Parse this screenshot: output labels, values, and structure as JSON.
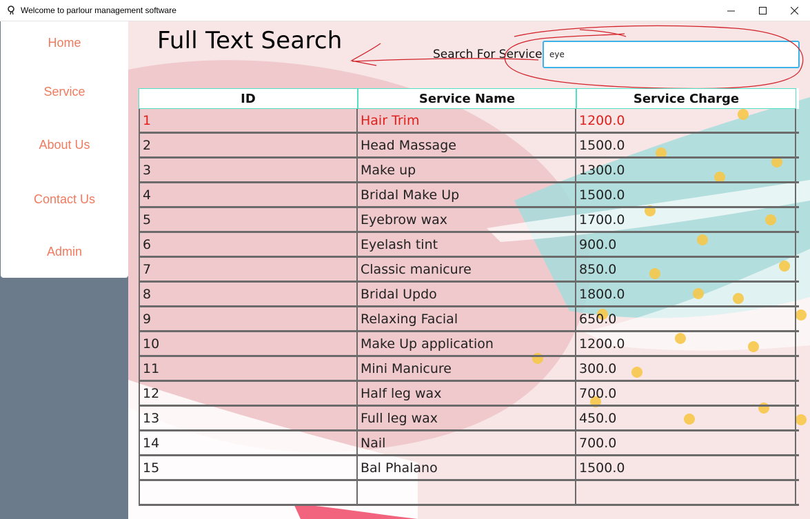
{
  "window": {
    "title": "Welcome to parlour management software"
  },
  "sidebar": {
    "items": [
      {
        "label": "Home"
      },
      {
        "label": "Service"
      },
      {
        "label": "About Us"
      },
      {
        "label": "Contact Us"
      },
      {
        "label": "Admin"
      }
    ]
  },
  "page": {
    "title": "Full Text Search",
    "search_label": "Search For Service:",
    "search_value": "eye"
  },
  "table": {
    "headers": [
      "ID",
      "Service Name",
      "Service Charge"
    ],
    "rows": [
      {
        "id": "1",
        "name": "Hair Trim",
        "charge": "1200.0"
      },
      {
        "id": "2",
        "name": "Head Massage",
        "charge": "1500.0"
      },
      {
        "id": "3",
        "name": "Make up",
        "charge": "1300.0"
      },
      {
        "id": "4",
        "name": "Bridal Make Up",
        "charge": "1500.0"
      },
      {
        "id": "5",
        "name": "Eyebrow wax",
        "charge": "1700.0"
      },
      {
        "id": "6",
        "name": "Eyelash tint",
        "charge": "900.0"
      },
      {
        "id": "7",
        "name": "Classic manicure",
        "charge": "850.0"
      },
      {
        "id": "8",
        "name": "Bridal Updo",
        "charge": "1800.0"
      },
      {
        "id": "9",
        "name": "Relaxing Facial",
        "charge": "650.0"
      },
      {
        "id": "10",
        "name": "Make Up application",
        "charge": "1200.0"
      },
      {
        "id": "11",
        "name": "Mini Manicure",
        "charge": "300.0"
      },
      {
        "id": "12",
        "name": "Half leg wax",
        "charge": "700.0"
      },
      {
        "id": "13",
        "name": "Full leg wax",
        "charge": "450.0"
      },
      {
        "id": "14",
        "name": "Nail",
        "charge": "700.0"
      },
      {
        "id": "15",
        "name": "Bal Phalano",
        "charge": "1500.0"
      },
      {
        "id": "",
        "name": "",
        "charge": ""
      }
    ],
    "selected_row": 0
  },
  "colors": {
    "nav_text": "#f07a5e",
    "sidebar_bg": "#6b7b8b",
    "selected_text": "#e0201a",
    "header_border": "#4fe0c7",
    "search_border": "#3ab3e8",
    "annotation": "#d2222a"
  },
  "icons": {
    "app": "hair-dryer-icon",
    "minimize": "minimize-icon",
    "maximize": "maximize-icon",
    "close": "close-icon"
  }
}
